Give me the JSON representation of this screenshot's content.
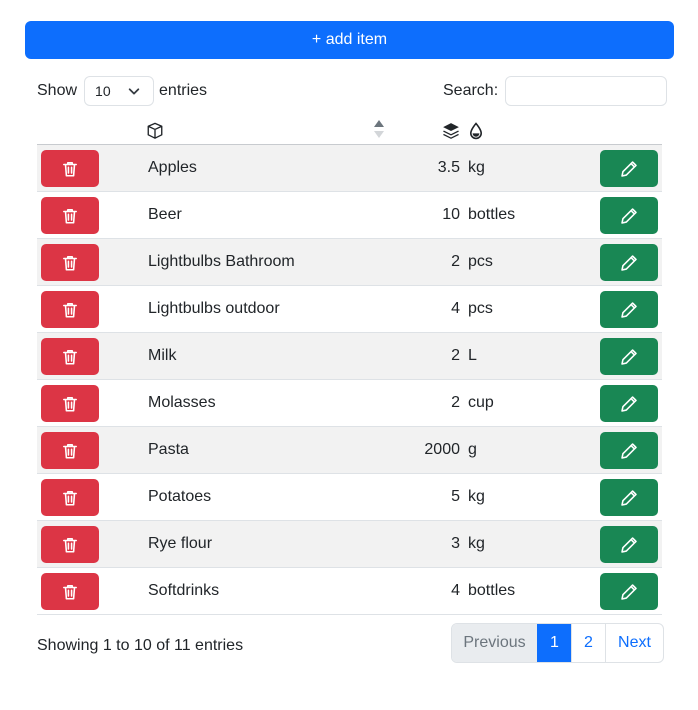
{
  "toolbar": {
    "add_label": "+ add item"
  },
  "length": {
    "show_label": "Show",
    "selected": "10",
    "entries_label": "entries"
  },
  "search": {
    "label": "Search:",
    "value": "",
    "placeholder": ""
  },
  "columns": {
    "name_icon": "box-icon",
    "sort_icon": "sort-arrows-icon",
    "quantity_icon": "layers-icon",
    "unit_icon": "droplet-icon"
  },
  "rows": [
    {
      "name": "Apples",
      "quantity": "3.5",
      "unit": "kg"
    },
    {
      "name": "Beer",
      "quantity": "10",
      "unit": "bottles"
    },
    {
      "name": "Lightbulbs Bathroom",
      "quantity": "2",
      "unit": "pcs"
    },
    {
      "name": "Lightbulbs outdoor",
      "quantity": "4",
      "unit": "pcs"
    },
    {
      "name": "Milk",
      "quantity": "2",
      "unit": "L"
    },
    {
      "name": "Molasses",
      "quantity": "2",
      "unit": "cup"
    },
    {
      "name": "Pasta",
      "quantity": "2000",
      "unit": "g"
    },
    {
      "name": "Potatoes",
      "quantity": "5",
      "unit": "kg"
    },
    {
      "name": "Rye flour",
      "quantity": "3",
      "unit": "kg"
    },
    {
      "name": "Softdrinks",
      "quantity": "4",
      "unit": "bottles"
    }
  ],
  "row_icons": {
    "delete": "trash-icon",
    "edit": "pencil-icon"
  },
  "footer": {
    "info": "Showing 1 to 10 of 11 entries",
    "pagination": {
      "previous": "Previous",
      "pages": [
        "1",
        "2"
      ],
      "current": "1",
      "next": "Next"
    }
  },
  "colors": {
    "primary": "#0d6efd",
    "danger": "#dc3545",
    "success": "#198754",
    "stripe": "#f2f2f2"
  }
}
